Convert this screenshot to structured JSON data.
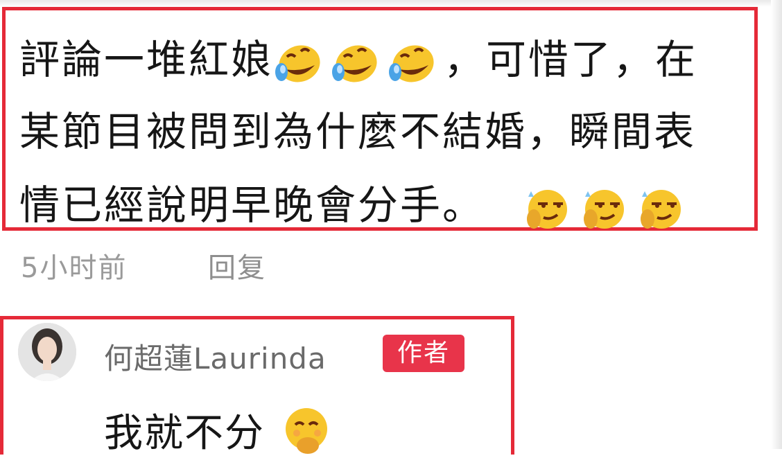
{
  "comment": {
    "line1_text": "評論一堆紅娘",
    "line1_tail": "，可惜了，在",
    "line2_text": "某節目被問到為什麼不結婚，瞬間表",
    "line3_text": "情已經說明早晚會分手。",
    "line1_emojis": [
      "rofl-emoji",
      "rofl-emoji",
      "rofl-emoji"
    ],
    "line3_emojis": [
      "smirk-sweat-emoji",
      "smirk-sweat-emoji",
      "smirk-sweat-emoji"
    ]
  },
  "meta": {
    "time_ago": "5小时前",
    "reply_label": "回复"
  },
  "reply": {
    "username": "何超蓮Laurinda",
    "author_badge": "作者",
    "text": "我就不分",
    "emoji": "smile-hand-emoji"
  },
  "colors": {
    "highlight": "#e52a38",
    "badge": "#e8344a",
    "meta_text": "#9a9a9a",
    "username_text": "#6a6a6a"
  }
}
